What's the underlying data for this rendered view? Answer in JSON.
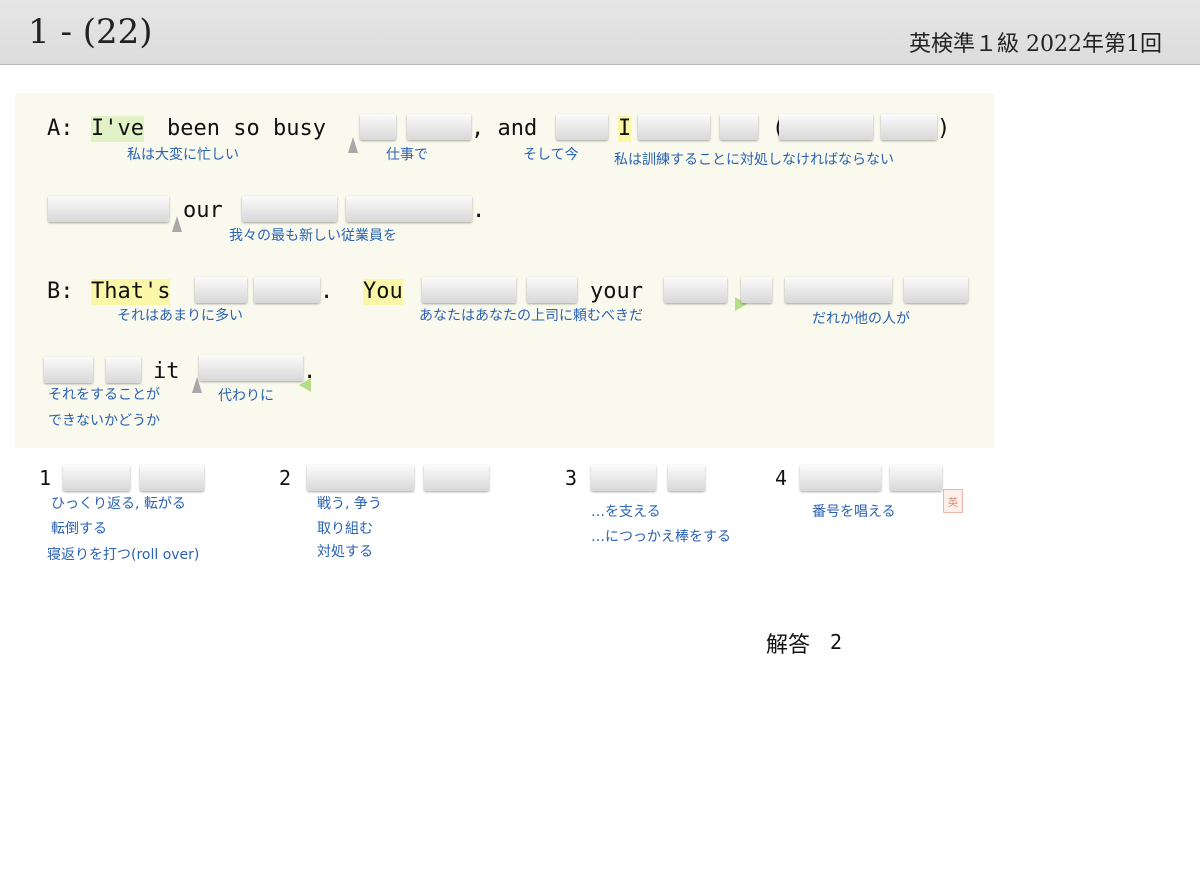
{
  "header": {
    "question_number": "1 - (22)",
    "exam_title": "英検準１級  2022年第1回"
  },
  "passage": {
    "a_label": "A:",
    "a_word_ive": "I've",
    "a_been_so_busy": "been so busy",
    "a_comma_and": ", and",
    "a_word_i": "I",
    "a_paren_open": "(",
    "a_paren_close": ")",
    "a_our": "our",
    "a_period": ".",
    "a_gloss_busy": "私は大変に忙しい",
    "a_gloss_work": "仕事で",
    "a_gloss_now": "そして今",
    "a_gloss_deal": "私は訓練することに対処しなければならない",
    "a_gloss_staff": "我々の最も新しい従業員を",
    "b_label": "B:",
    "b_word_thats": "That's",
    "b_period1": ".",
    "b_word_you": "You",
    "b_your": "your",
    "b_it": "it",
    "b_period2": ".",
    "b_gloss_toomuch": "それはあまりに多い",
    "b_gloss_boss": "あなたはあなたの上司に頼むべきだ",
    "b_gloss_someone": "だれか他の人が",
    "b_gloss_can_line1": "それをすることが",
    "b_gloss_can_line2": "できないかどうか",
    "b_gloss_instead": "代わりに",
    "stamp": "英"
  },
  "options": [
    {
      "number": "1",
      "gloss_lines": [
        "ひっくり返る, 転がる",
        "転倒する",
        "寝返りを打つ(roll over)"
      ]
    },
    {
      "number": "2",
      "gloss_lines": [
        "戦う, 争う",
        "取り組む",
        "対処する"
      ]
    },
    {
      "number": "3",
      "gloss_lines": [
        "…を支える",
        "…につっかえ棒をする"
      ]
    },
    {
      "number": "4",
      "gloss_lines": [
        "番号を唱える"
      ]
    }
  ],
  "answer": {
    "label": "解答",
    "value": "2"
  }
}
